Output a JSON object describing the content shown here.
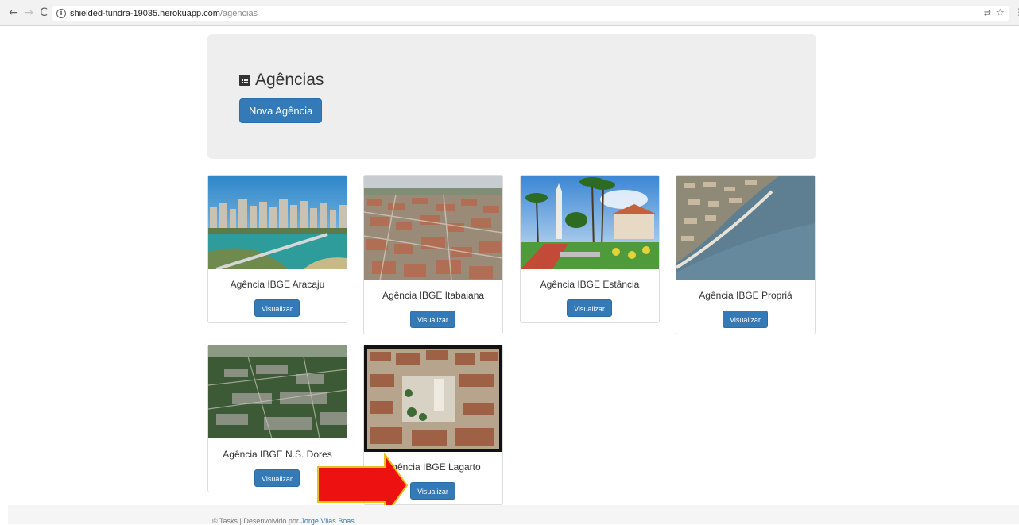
{
  "browser": {
    "url_host": "shielded-tundra-19035.herokuapp.com",
    "url_path": "/agencias",
    "back_icon": "←",
    "forward_icon": "→",
    "reload_icon": "C",
    "info_icon": "i",
    "translate_icon": "⇄",
    "star_icon": "☆",
    "menu_icon": "⋮"
  },
  "header": {
    "title": "Agências",
    "new_button": "Nova Agência"
  },
  "agencies": [
    {
      "name": "Agência IBGE Aracaju",
      "button": "Visualizar"
    },
    {
      "name": "Agência IBGE Itabaiana",
      "button": "Visualizar"
    },
    {
      "name": "Agência IBGE Estância",
      "button": "Visualizar"
    },
    {
      "name": "Agência IBGE Propriá",
      "button": "Visualizar"
    },
    {
      "name": "Agência IBGE N.S. Dores",
      "button": "Visualizar"
    },
    {
      "name": "Agência IBGE Lagarto",
      "button": "Visualizar"
    }
  ],
  "footer": {
    "text": "© Tasks | Desenvolvido por",
    "author": "Jorge Vilas Boas"
  },
  "colors": {
    "primary": "#337ab7",
    "jumbotron": "#eeeeee",
    "arrow_fill": "#ee1111",
    "arrow_stroke": "#e8c020"
  }
}
